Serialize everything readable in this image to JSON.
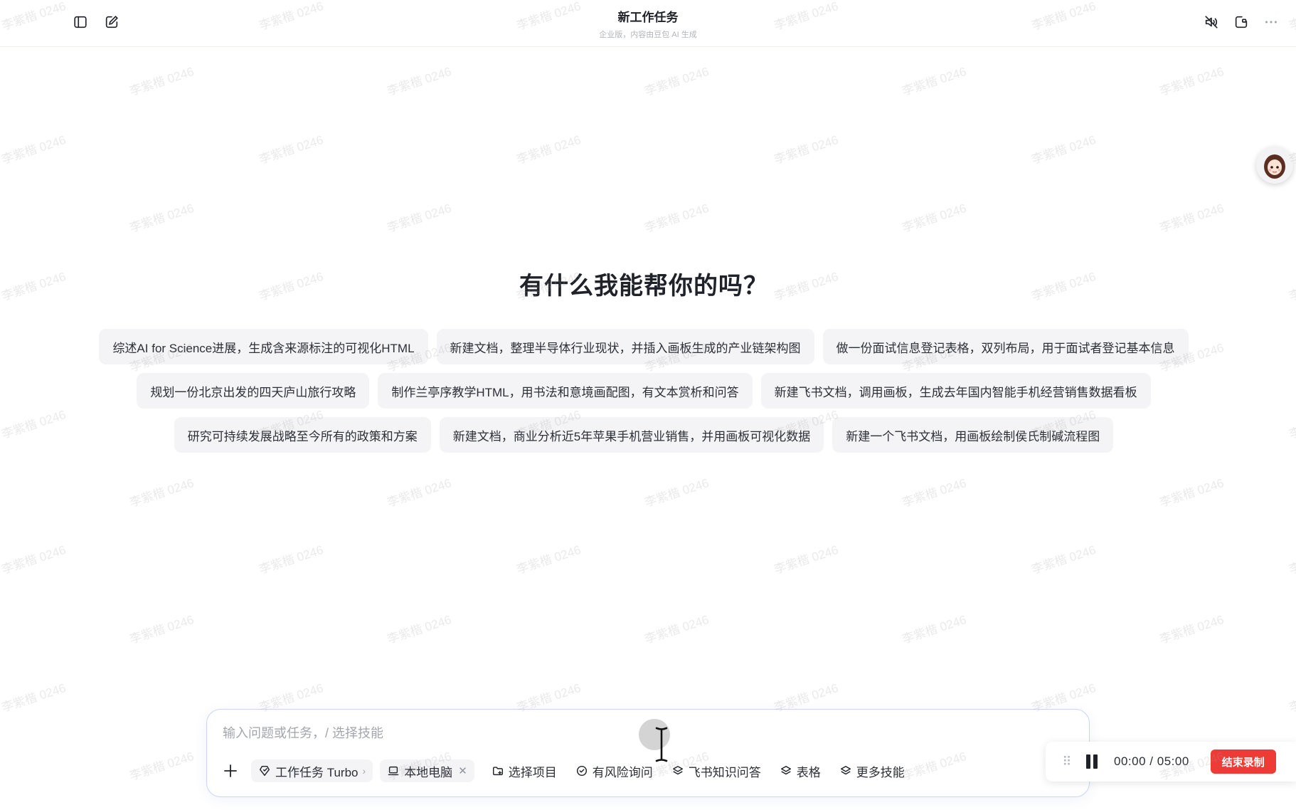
{
  "header": {
    "title": "新工作任务",
    "subtitle": "企业版，内容由豆包 AI 生成",
    "icons": [
      "sidebar-toggle-icon",
      "new-task-icon",
      "mute-icon",
      "window-icon",
      "more-icon"
    ]
  },
  "main": {
    "headline": "有什么我能帮你的吗？",
    "suggestion_rows": [
      [
        "综述AI for Science进展，生成含来源标注的可视化HTML",
        "新建文档，整理半导体行业现状，并插入画板生成的产业链架构图",
        "做一份面试信息登记表格，双列布局，用于面试者登记基本信息"
      ],
      [
        "规划一份北京出发的四天庐山旅行攻略",
        "制作兰亭序教学HTML，用书法和意境画配图，有文本赏析和问答",
        "新建飞书文档，调用画板，生成去年国内智能手机经营销售数据看板"
      ],
      [
        "研究可持续发展战略至今所有的政策和方案",
        "新建文档，商业分析近5年苹果手机营业销售，并用画板可视化数据",
        "新建一个飞书文档，用画板绘制侯氏制碱流程图"
      ]
    ]
  },
  "composer": {
    "placeholder": "输入问题或任务，/ 选择技能",
    "mode_label": "工作任务 Turbo",
    "device_label": "本地电脑",
    "select_project": "选择项目",
    "risk_inquiry": "有风险询问",
    "knowledge_qa": "飞书知识问答",
    "table": "表格",
    "more_skills": "更多技能"
  },
  "recorder": {
    "time": "00:00",
    "separator": "/",
    "duration": "05:00",
    "end_label": "结束录制",
    "accent": "#ef3b35"
  },
  "watermark": "李紫楷 0246",
  "colors": {
    "composer_border": "#c9d6f5",
    "chip_bg": "#f4f4f6"
  }
}
